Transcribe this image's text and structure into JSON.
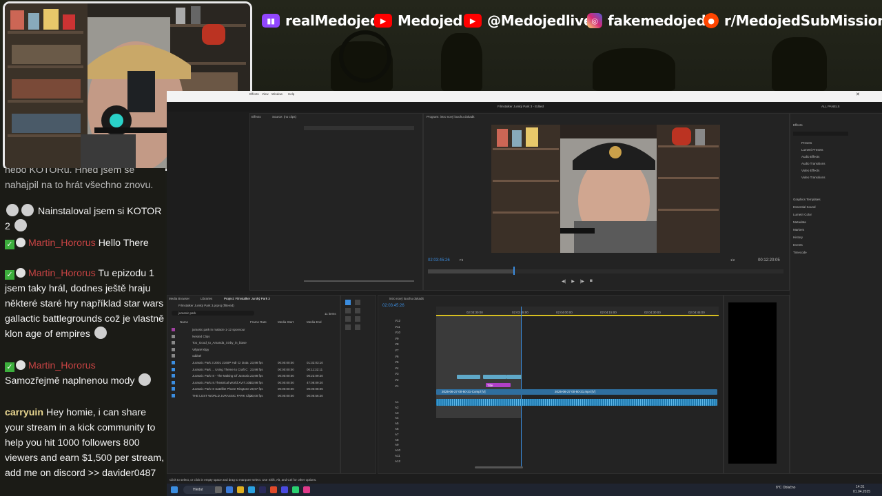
{
  "banner": {
    "socials": [
      {
        "platform": "twitch-icon",
        "handle": "realMedojed",
        "color": "#9146ff"
      },
      {
        "platform": "youtube-icon",
        "handle": "Medojed",
        "color": "#ff0000"
      },
      {
        "platform": "youtube-icon",
        "handle": "@Medojedlive",
        "color": "#ff0000"
      },
      {
        "platform": "instagram-icon",
        "handle": "fakemedojed",
        "color": "#d6249f"
      },
      {
        "platform": "reddit-icon",
        "handle": "r/MedojedSubMissions",
        "color": "#ff4500"
      }
    ]
  },
  "chat": {
    "messages": [
      {
        "text": "nebo KOTORu. Hned jsem se nahajpil na to hrát všechno znovu."
      },
      {
        "text": "Nainstaloval jsem si KOTOR 2"
      },
      {
        "user": "Martin_Hororus",
        "text": "Hello There"
      },
      {
        "user": "Martin_Hororus",
        "text": "Tu epizodu 1 jsem taky hrál, dodnes ještě hraju některé staré hry například star wars gallactic battlegrounds což je vlastně klon age of empires"
      },
      {
        "user": "Martin_Hororus",
        "text": "Samozřejmě naplnenou mody"
      },
      {
        "user": "carryuin",
        "text": "Hey homie, i can share your stream in a kick community to help you hit 1000 followers 800 viewers and earn $1,500 per stream, add me on discord >> davider0487"
      }
    ]
  },
  "premiere": {
    "title": "Filmstalker Jurský Park 3 - Edited",
    "menu": [
      "Effects",
      "View",
      "Window",
      "Help"
    ],
    "source_tabs": [
      "Effects",
      "Source: (no clips)"
    ],
    "program_title": "Program: intro nový louchu dokadit",
    "program_timecode": "02:03:45:26",
    "program_duration": "00:12:20:05",
    "fit": "Fit",
    "quality": "1/2",
    "workspace": "ALL PANELS",
    "right_panel": {
      "title": "Effects",
      "items": [
        "Presets",
        "Lumetri Presets",
        "Audio Effects",
        "Audio Transitions",
        "Video Effects",
        "Video Transitions"
      ],
      "sections": [
        "Graphics Templates",
        "Essential Sound",
        "Lumetri Color",
        "Metadata",
        "Markers",
        "History",
        "Events",
        "Timecode"
      ]
    },
    "project": {
      "tabs": [
        "Media Browser",
        "Libraries",
        "Project: Filmstalker Jurský Park 3"
      ],
      "file": "Filmstalker Jurský Park 3.prproj (filtered)",
      "search": "jurassic park",
      "item_count": "11 items",
      "columns": [
        "Name",
        "Frame Rate",
        "Media Start",
        "Media End"
      ],
      "rows": [
        {
          "name": "jurassic park in malacie 1-12 sponsour",
          "fps": "",
          "start": "",
          "end": ""
        },
        {
          "name": "Nested Clips",
          "fps": "",
          "start": "",
          "end": ""
        },
        {
          "name": "Too_Good_to_Amanda_XXby_in_biase",
          "fps": "",
          "start": "",
          "end": ""
        },
        {
          "name": "Vějané klipy",
          "fps": "",
          "start": "",
          "end": ""
        },
        {
          "name": "oddsel",
          "fps": "",
          "start": "",
          "end": ""
        },
        {
          "name": "Jurassic Park 3 2001 2160P Hdr Cr Duta",
          "fps": "23,98 fps",
          "start": "00:00:00:00",
          "end": "01:32:03:10"
        },
        {
          "name": "Jurassic Park ... Using Theme to Craft C",
          "fps": "23,98 fps",
          "start": "00:00:00:00",
          "end": "00:11:32:11"
        },
        {
          "name": "Jurassic Park III - The Making Of Jurassic",
          "fps": "23,98 fps",
          "start": "00:00:00:00",
          "end": "00:22:09:20"
        },
        {
          "name": "Jurassic.Park.III.Theatrical.World.XVIT.108",
          "fps": "23,98 fps",
          "start": "00:00:00:00",
          "end": "47:08:09:20"
        },
        {
          "name": "Jurassic Park III Satellite Phone Ringtone",
          "fps": "29,97 fps",
          "start": "00:00:00:00",
          "end": "00:00:08:06"
        },
        {
          "name": "THE LOST WORLD JURASSIC PARK Clip",
          "fps": "30,00 fps",
          "start": "00:00:00:00",
          "end": "00:06:56:20"
        }
      ]
    },
    "timeline": {
      "tab": "intro nový louchu dokadit",
      "timecode": "02:03:45:26",
      "ruler": [
        "02:03:30:00",
        "02:03:45:00",
        "02:04:00:00",
        "02:04:15:00",
        "02:04:30:00",
        "02:04:45:00"
      ],
      "video_tracks": [
        "V12",
        "V11",
        "V10",
        "V9",
        "V8",
        "V7",
        "V6",
        "V5",
        "V4",
        "V3",
        "V2",
        "V1"
      ],
      "audio_tracks": [
        "A1",
        "A2",
        "A3",
        "A4",
        "A5",
        "A6",
        "A7",
        "A8",
        "A9",
        "A10",
        "A11",
        "A12"
      ],
      "clip_labels": [
        "2025-06-27 00-50-21-Compl [V]",
        "2025-06-27 00-50-21.mp4 [V]",
        "Title"
      ]
    },
    "status_bar": "Click to select, or click in empty space and drag to marquee select. Use Shift, Alt, and Ctrl for other options."
  },
  "taskbar": {
    "search": "Hledat",
    "weather": "8°C Oblačno",
    "time": "14:31",
    "date": "01.04.2025"
  }
}
